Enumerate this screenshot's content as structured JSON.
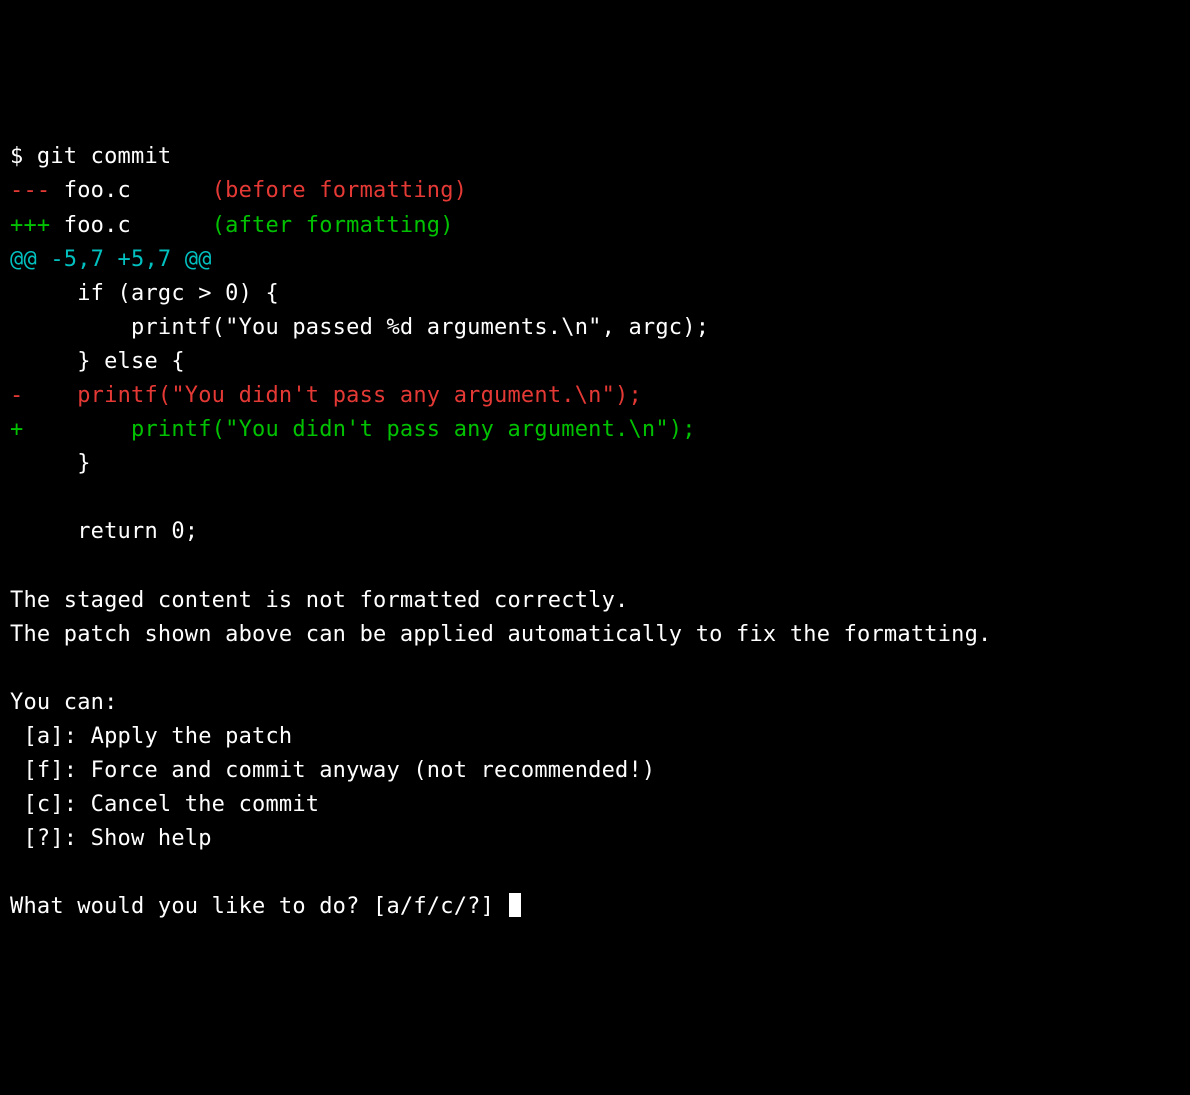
{
  "prompt_symbol": "$ ",
  "command": "git commit",
  "diff": {
    "minus_header_prefix": "--- ",
    "minus_header_file": "foo.c",
    "minus_header_pad": "      ",
    "minus_header_note": "(before formatting)",
    "plus_header_prefix": "+++ ",
    "plus_header_file": "foo.c",
    "plus_header_pad": "      ",
    "plus_header_note": "(after formatting)",
    "hunk": "@@ -5,7 +5,7 @@",
    "context_1": "     if (argc > 0) {",
    "context_2": "         printf(\"You passed %d arguments.\\n\", argc);",
    "context_3": "     } else {",
    "removed_marker": "-",
    "removed_rest": "    printf(\"You didn't pass any argument.\\n\");",
    "added_marker": "+",
    "added_rest": "        printf(\"You didn't pass any argument.\\n\");",
    "context_4": "     }",
    "context_5": " ",
    "context_6": "     return 0;"
  },
  "message_1": "The staged content is not formatted correctly.",
  "message_2": "The patch shown above can be applied automatically to fix the formatting.",
  "options_header": "You can:",
  "options": {
    "a": " [a]: Apply the patch",
    "f": " [f]: Force and commit anyway (not recommended!)",
    "c": " [c]: Cancel the commit",
    "q": " [?]: Show help"
  },
  "question": "What would you like to do? [a/f/c/?] "
}
